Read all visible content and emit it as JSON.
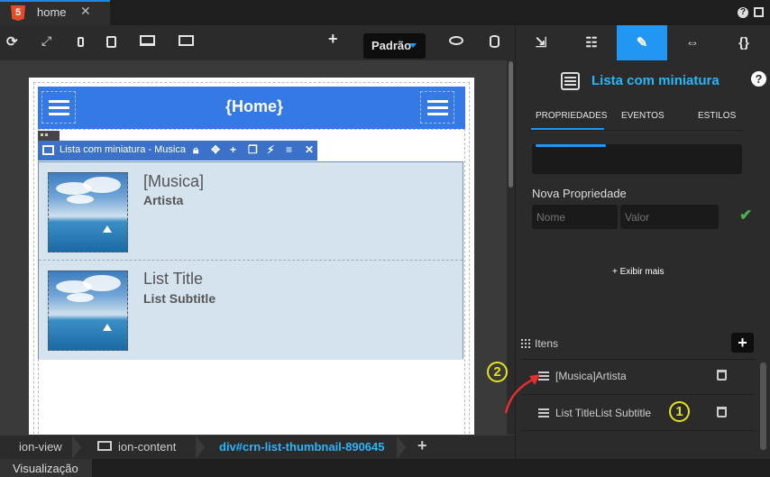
{
  "tab": {
    "badge": "5",
    "label": "home",
    "close": "✕"
  },
  "window": {
    "help": "?"
  },
  "toolbar": {
    "refresh_icon": "refresh-icon",
    "expand_icon": "expand-icon",
    "add": "+",
    "theme": "Padrão"
  },
  "canvas": {
    "page_title": "{Home}",
    "component_label": "Lista com miniatura - Musica",
    "list_items": [
      {
        "title": "[Musica]",
        "subtitle": "Artista"
      },
      {
        "title": "List Title",
        "subtitle": "List Subtitle"
      }
    ]
  },
  "breadcrumb": {
    "items": [
      "ion-view",
      "ion-content",
      "div#crn-list-thumbnail-890645"
    ],
    "add": "+"
  },
  "status": {
    "label": "Visualização"
  },
  "panel": {
    "tabs": [
      "⇲",
      "☷",
      "✎",
      "⇔",
      "{}"
    ],
    "title": "Lista com miniatura",
    "help": "?",
    "subtabs": [
      "PROPRIEDADES",
      "EVENTOS",
      "ESTILOS"
    ],
    "new_property": {
      "label": "Nova Propriedade",
      "name_placeholder": "Nome",
      "value_placeholder": "Valor",
      "confirm": "✔"
    },
    "show_more": "+ Exibir mais",
    "items_label": "Itens",
    "items_add": "+",
    "items": [
      "[Musica]Artista",
      "List TitleList Subtitle"
    ]
  },
  "annotations": [
    "2",
    "1"
  ],
  "colors": {
    "accent": "#2196f3",
    "header": "#3479e5",
    "list_bg": "#d5e3ef",
    "highlight": "#29b6f6",
    "annotation": "#e3e31a",
    "arrow": "#e52e2e"
  }
}
